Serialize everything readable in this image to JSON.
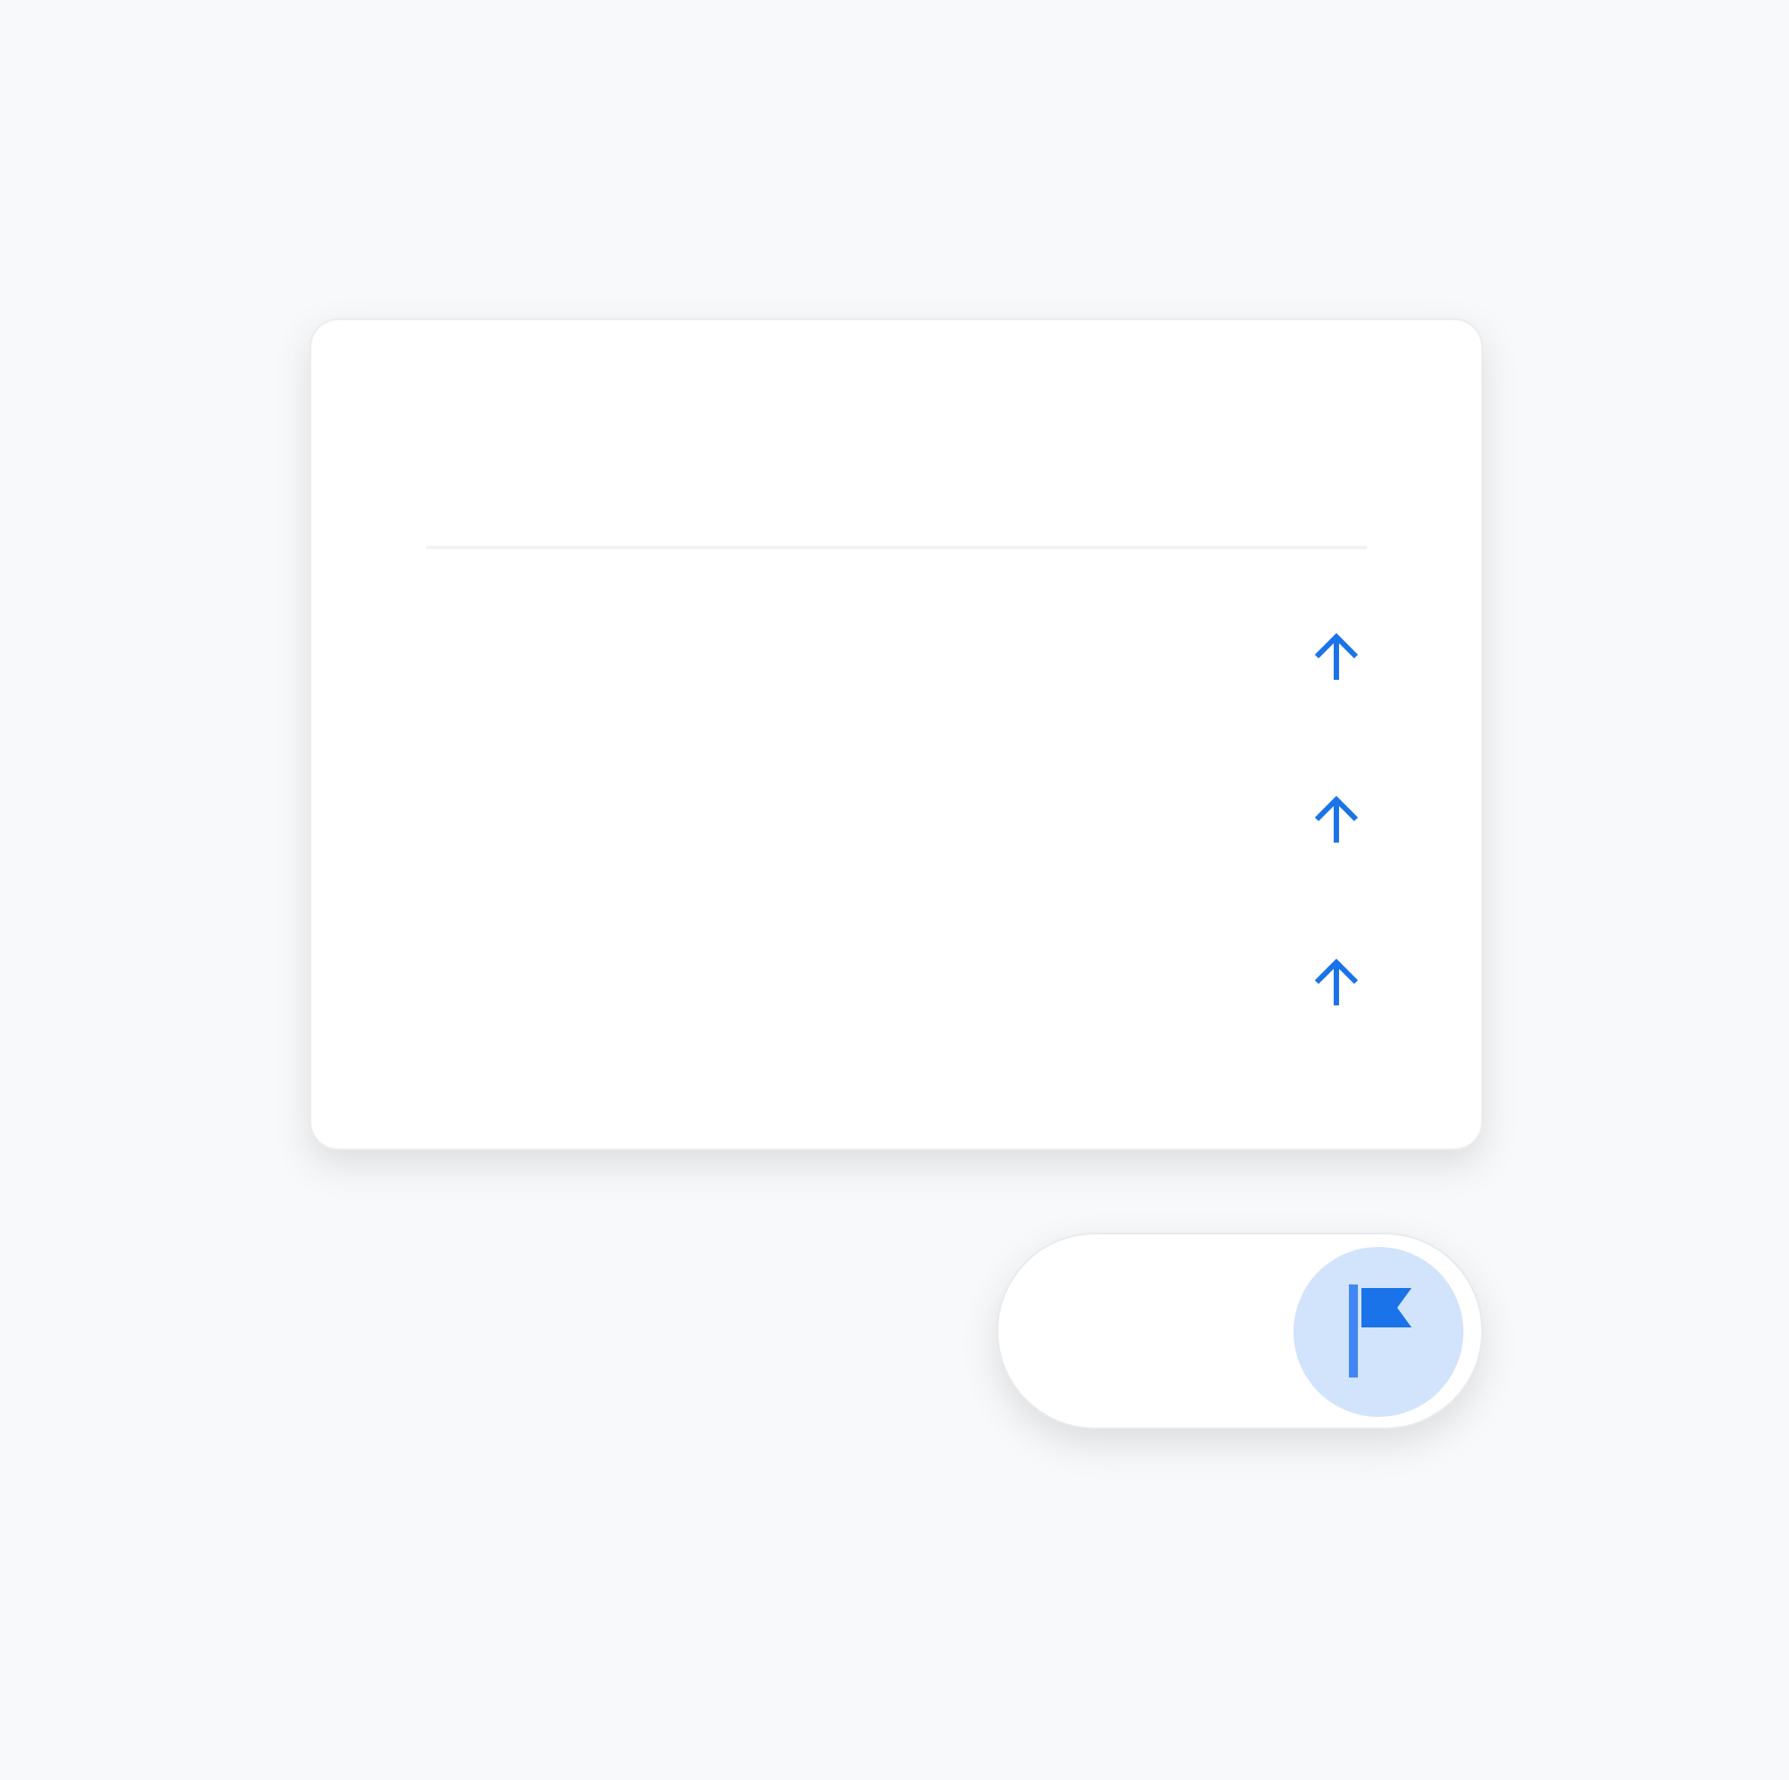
{
  "card": {
    "rows": [
      {
        "kind": "arrow-up"
      },
      {
        "kind": "arrow-up"
      },
      {
        "kind": "arrow-up"
      }
    ]
  },
  "toggle": {
    "on": true
  }
}
